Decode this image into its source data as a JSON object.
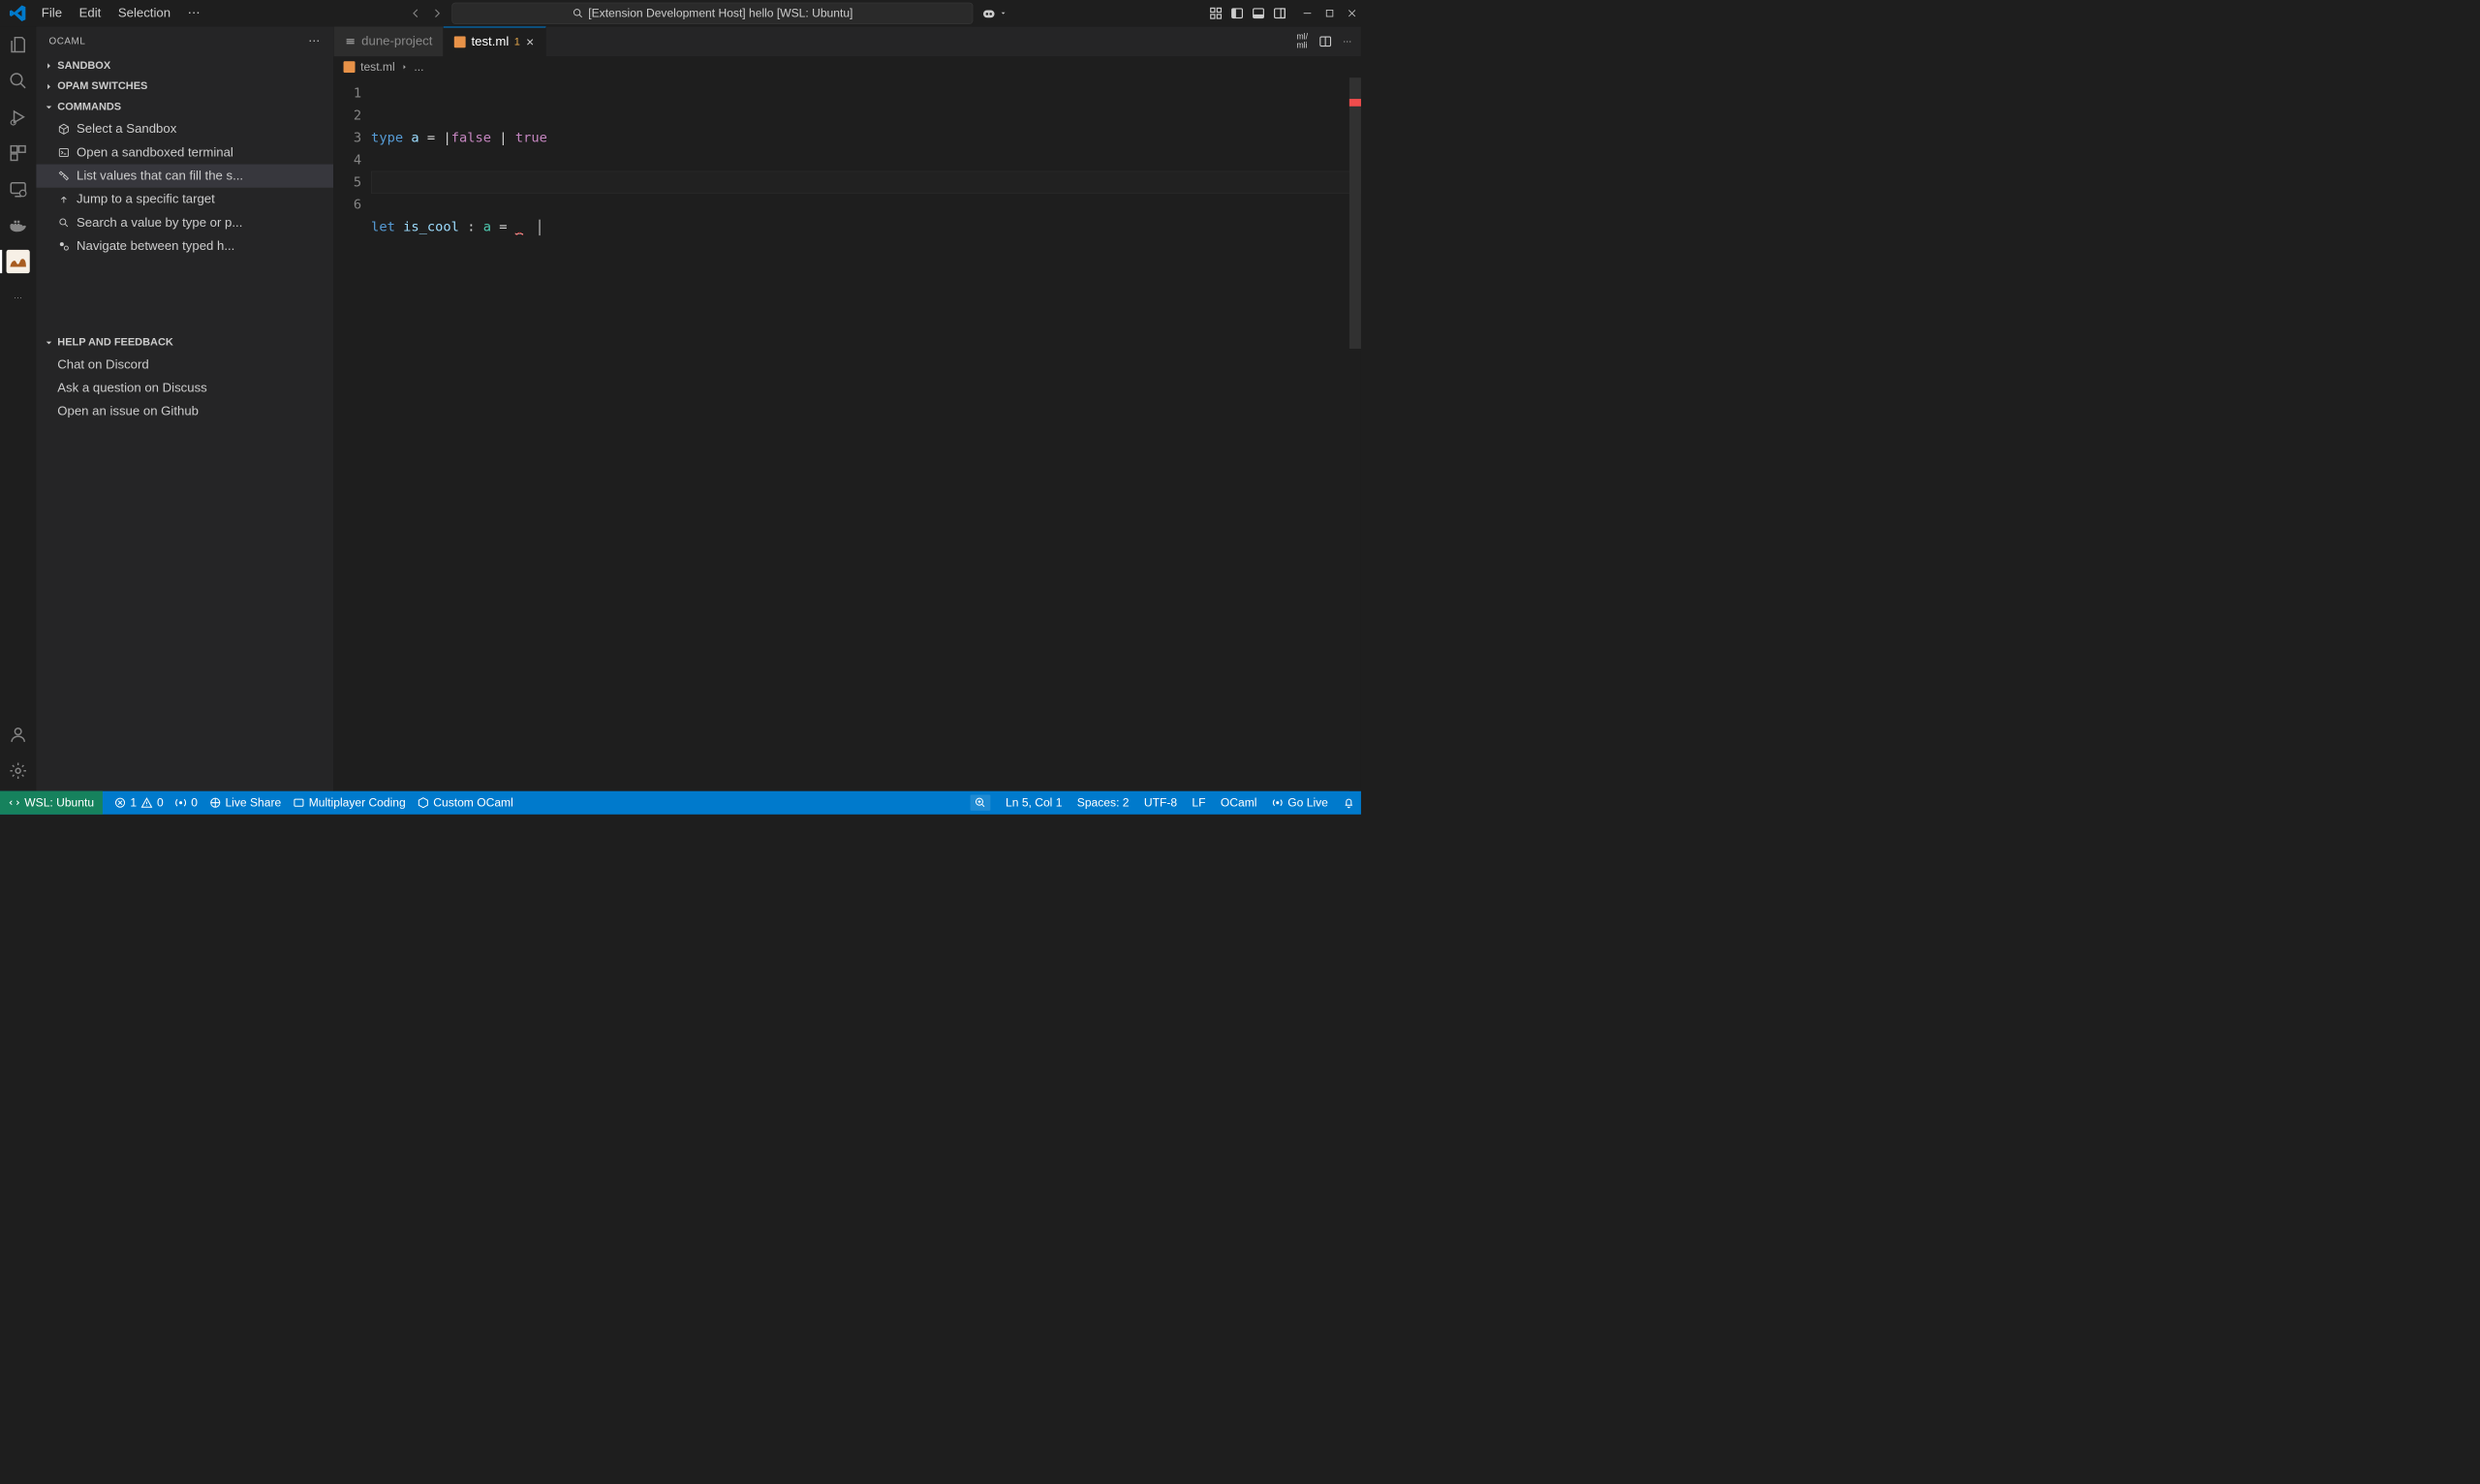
{
  "titlebar": {
    "menus": [
      "File",
      "Edit",
      "Selection"
    ],
    "search_label": "[Extension Development Host] hello [WSL: Ubuntu]"
  },
  "sidebar": {
    "title": "OCAML",
    "sections": {
      "sandbox": "SANDBOX",
      "opam": "OPAM SWITCHES",
      "commands": "COMMANDS",
      "help": "HELP AND FEEDBACK"
    },
    "commands": [
      "Select a Sandbox",
      "Open a sandboxed terminal",
      "List values that can fill the s...",
      "Jump to a specific target",
      "Search a value by type or p...",
      "Navigate between typed h..."
    ],
    "help_items": [
      "Chat on Discord",
      "Ask a question on Discuss",
      "Open an issue on Github"
    ]
  },
  "tabs": [
    {
      "label": "dune-project",
      "active": false
    },
    {
      "label": "test.ml",
      "active": true,
      "badge": "1"
    }
  ],
  "breadcrumb": {
    "file": "test.ml",
    "rest": "..."
  },
  "code": {
    "lines": [
      "1",
      "2",
      "3",
      "4",
      "5",
      "6"
    ],
    "line1": {
      "kw": "type",
      "id": "a",
      "eq": "=",
      "bar1": "|",
      "c1": "false",
      "bar2": "|",
      "c2": "true"
    },
    "line3": {
      "kw": "let",
      "id": "is_cool",
      "col": ":",
      "typ": "a",
      "eq": "=",
      "hole": "_"
    }
  },
  "statusbar": {
    "remote": "WSL: Ubuntu",
    "errors": "1",
    "warnings": "0",
    "ports": "0",
    "live_share": "Live Share",
    "multiplayer": "Multiplayer Coding",
    "custom_ocaml": "Custom OCaml",
    "position": "Ln 5, Col 1",
    "spaces": "Spaces: 2",
    "encoding": "UTF-8",
    "eol": "LF",
    "language": "OCaml",
    "go_live": "Go Live"
  }
}
